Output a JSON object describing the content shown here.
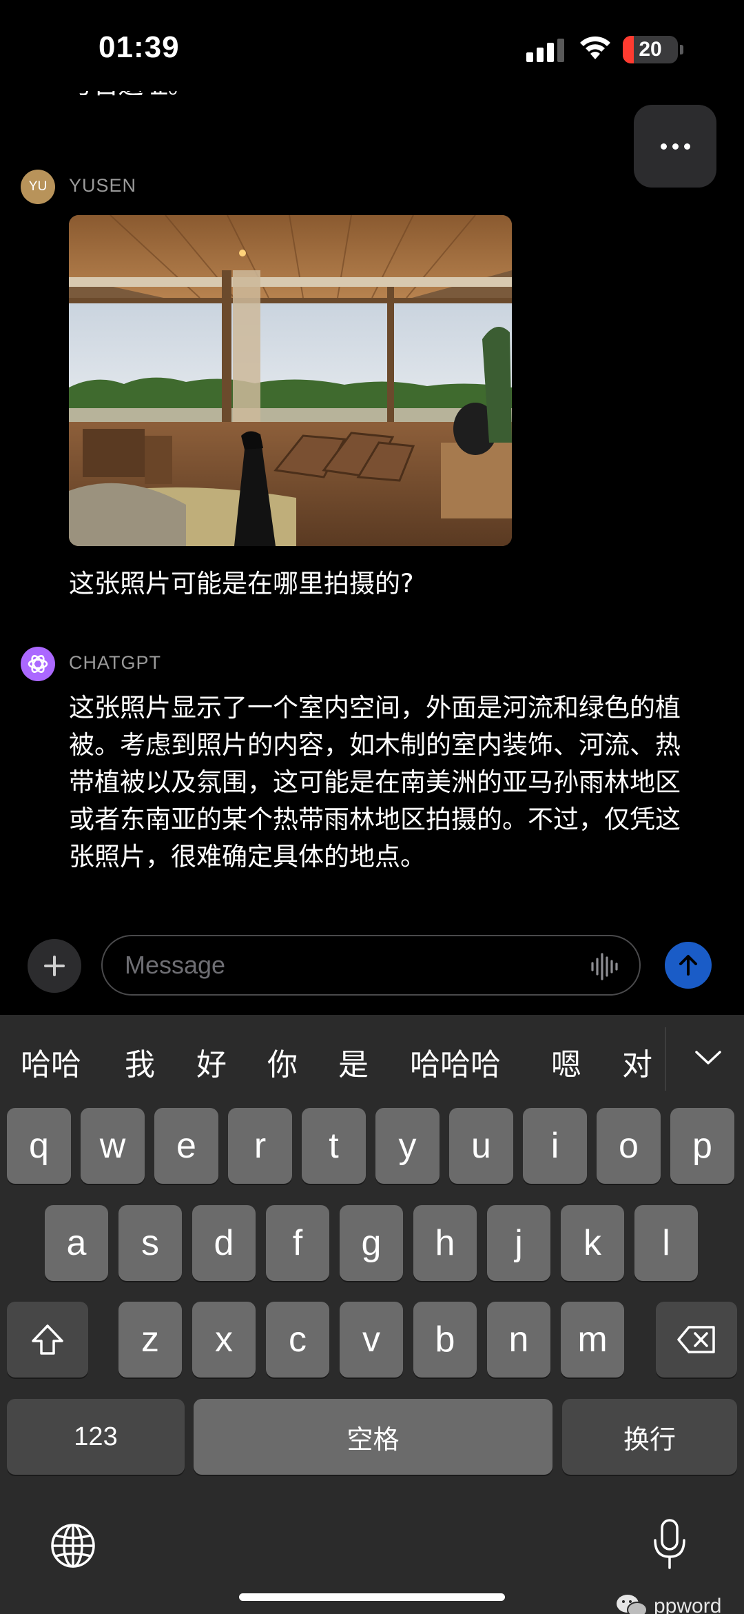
{
  "status_bar": {
    "time": "01:39",
    "battery_level": "20",
    "battery_fraction": 0.2
  },
  "conversation": {
    "partial_previous_text": "考古遗址。",
    "user": {
      "avatar_initials": "YU",
      "name": "YUSEN",
      "message": "这张照片可能是在哪里拍摄的?"
    },
    "assistant": {
      "name": "CHATGPT",
      "message": "这张照片显示了一个室内空间，外面是河流和绿色的植被。考虑到照片的内容，如木制的室内装饰、河流、热带植被以及氛围，这可能是在南美洲的亚马孙雨林地区或者东南亚的某个热带雨林地区拍摄的。不过，仅凭这张照片，很难确定具体的地点。"
    }
  },
  "composer": {
    "placeholder": "Message"
  },
  "keyboard": {
    "candidates": [
      "哈哈",
      "我",
      "好",
      "你",
      "是",
      "哈哈哈",
      "嗯",
      "对"
    ],
    "row1": [
      "q",
      "w",
      "e",
      "r",
      "t",
      "y",
      "u",
      "i",
      "o",
      "p"
    ],
    "row2": [
      "a",
      "s",
      "d",
      "f",
      "g",
      "h",
      "j",
      "k",
      "l"
    ],
    "row3": [
      "z",
      "x",
      "c",
      "v",
      "b",
      "n",
      "m"
    ],
    "numbers_label": "123",
    "space_label": "空格",
    "return_label": "换行"
  },
  "watermark": "ppword",
  "colors": {
    "accent_send": "#1a5cc7",
    "chatgpt_avatar": "#ab68ff",
    "user_avatar": "#b8935a",
    "battery_red": "#ff3b30"
  }
}
